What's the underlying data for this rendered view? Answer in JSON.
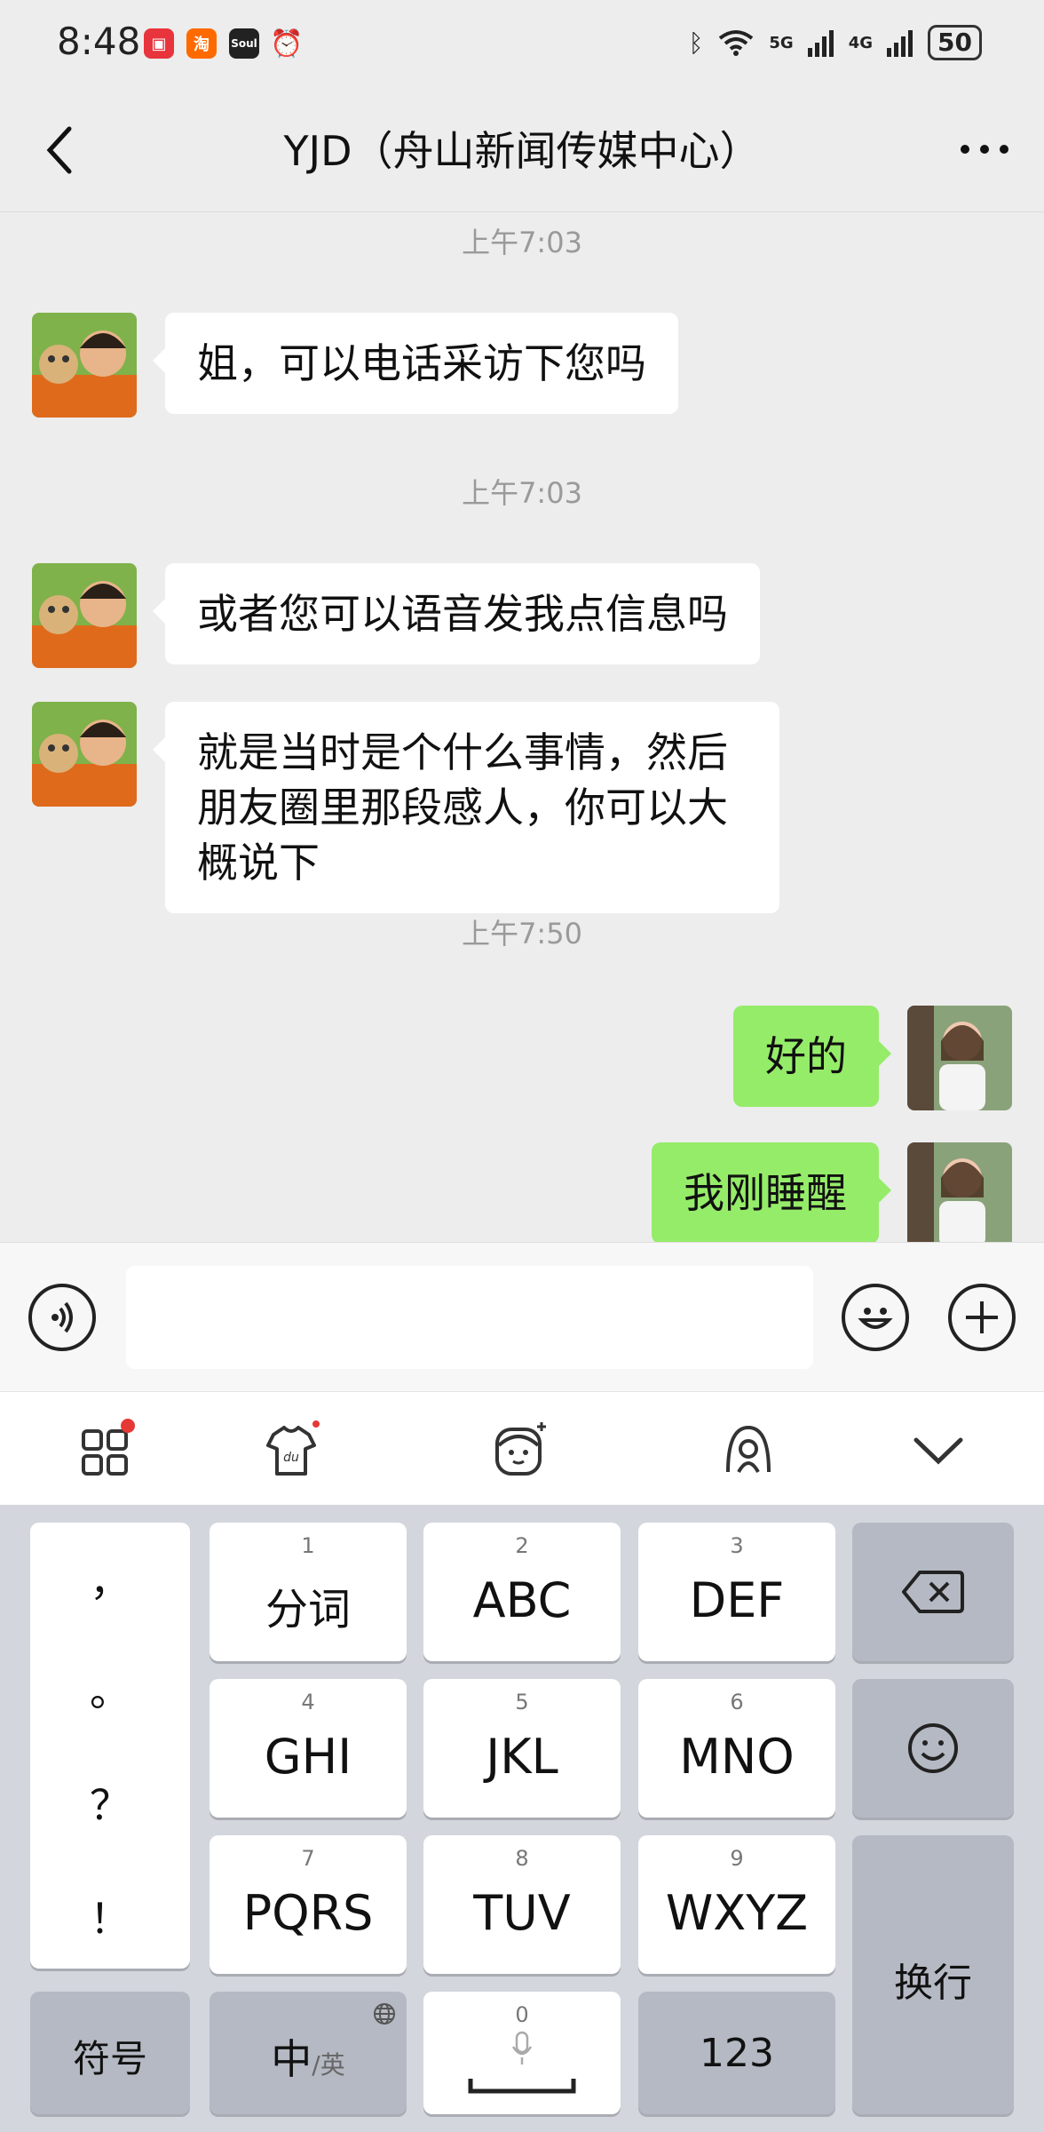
{
  "status_bar": {
    "time": "8:48",
    "app_icons": [
      "red-book-icon",
      "taobao-icon",
      "soul-icon",
      "alarm-icon"
    ],
    "signal_5g": "5G",
    "signal_4g": "4G",
    "battery": "50"
  },
  "nav": {
    "title": "YJD（舟山新闻传媒中心）"
  },
  "messages": [
    {
      "type": "time",
      "text": "上午7:03"
    },
    {
      "type": "in",
      "text": "姐，可以电话采访下您吗"
    },
    {
      "type": "time",
      "text": "上午7:03"
    },
    {
      "type": "in",
      "text": "或者您可以语音发我点信息吗"
    },
    {
      "type": "in",
      "text": "就是当时是个什么事情，然后朋友圈里那段感人，你可以大概说下"
    },
    {
      "type": "time",
      "text": "上午7:50"
    },
    {
      "type": "out",
      "text": "好的"
    },
    {
      "type": "out",
      "text": "我刚睡醒"
    }
  ],
  "input": {
    "placeholder": ""
  },
  "keyboard": {
    "punct": [
      "，",
      "。",
      "？",
      "！"
    ],
    "keys": [
      {
        "num": "1",
        "label": "分词"
      },
      {
        "num": "2",
        "label": "ABC"
      },
      {
        "num": "3",
        "label": "DEF"
      },
      {
        "num": "4",
        "label": "GHI"
      },
      {
        "num": "5",
        "label": "JKL"
      },
      {
        "num": "6",
        "label": "MNO"
      },
      {
        "num": "7",
        "label": "PQRS"
      },
      {
        "num": "8",
        "label": "TUV"
      },
      {
        "num": "9",
        "label": "WXYZ"
      }
    ],
    "symbol_label": "符号",
    "lang_main": "中",
    "lang_sub": "/英",
    "space_num": "0",
    "num_label": "123",
    "enter_label": "换行"
  },
  "colors": {
    "outgoing_bubble": "#95ec69",
    "badge_red": "#e53935"
  }
}
